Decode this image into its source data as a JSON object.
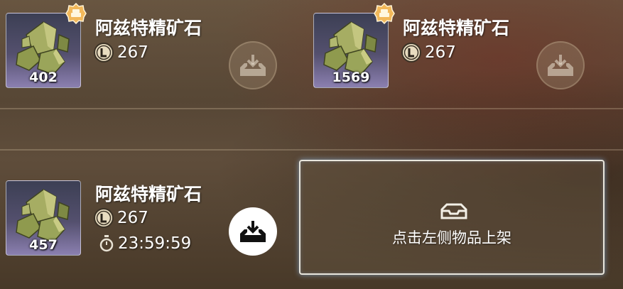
{
  "slots": [
    {
      "name": "阿兹特精矿石",
      "quantity": "402",
      "price": "267",
      "badge": true,
      "button_state": "disabled"
    },
    {
      "name": "阿兹特精矿石",
      "quantity": "1569",
      "price": "267",
      "badge": true,
      "button_state": "disabled"
    },
    {
      "name": "阿兹特精矿石",
      "quantity": "457",
      "price": "267",
      "timer": "23:59:59",
      "badge": false,
      "button_state": "active"
    }
  ],
  "empty_slot": {
    "hint": "点击左侧物品上架"
  },
  "icons": {
    "item": "ore-crystal-icon",
    "badge": "gold-badge-icon",
    "currency": "coin-L-icon",
    "timer": "stopwatch-icon",
    "list_button": "tray-download-icon",
    "empty_slot": "empty-tray-icon"
  },
  "colors": {
    "card_gradient_bottom": "#8b7fb0",
    "empty_border": "#e9e6dc",
    "badge": "#f2b85a",
    "ore": "#9aa55a"
  }
}
